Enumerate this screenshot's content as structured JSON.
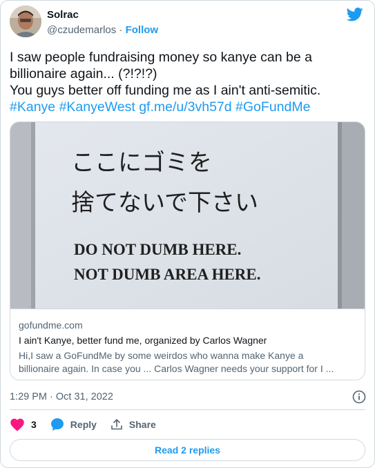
{
  "author": {
    "display_name": "Solrac",
    "handle": "@czudemarlos",
    "separator": "·",
    "follow_label": "Follow"
  },
  "tweet": {
    "line1": "I saw people fundraising money so kanye can be a",
    "line2": "billionaire again... (?!?!?)",
    "line3": "You guys better off funding me as I ain't anti-semitic.",
    "hashtags": [
      "#Kanye",
      "#KanyeWest",
      "gf.me/u/3vh57d",
      "#GoFundMe"
    ]
  },
  "card": {
    "image_text": {
      "jp_line1": "ここにゴミを",
      "jp_line2": "捨てないで下さい",
      "en_line1": "DO NOT DUMB HERE.",
      "en_line2": "NOT DUMB AREA HERE."
    },
    "domain": "gofundme.com",
    "title": "I ain't Kanye, better fund me, organized by Carlos Wagner",
    "description_line1": "Hi,I saw a GoFundMe by some weirdos who wanna make Kanye a",
    "description_line2": "billionaire again. In case you ... Carlos Wagner needs your support for I ..."
  },
  "timestamp": "1:29 PM · Oct 31, 2022",
  "actions": {
    "like_count": "3",
    "reply_label": "Reply",
    "share_label": "Share"
  },
  "read_replies_label": "Read 2 replies",
  "colors": {
    "accent": "#1d9bf0",
    "like": "#f91880",
    "text": "#0f1419",
    "muted": "#536471",
    "border": "#cfd9de"
  },
  "icons": [
    "twitter-bird-icon",
    "info-icon",
    "heart-icon",
    "reply-bubble-icon",
    "share-icon"
  ]
}
